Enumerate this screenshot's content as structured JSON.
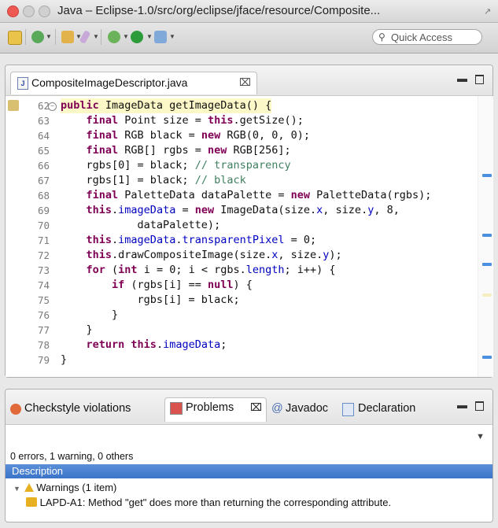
{
  "window": {
    "title": "Java – Eclipse-1.0/src/org/eclipse/jface/resource/Composite..."
  },
  "toolbar": {
    "quick_access_placeholder": "Quick Access"
  },
  "editor": {
    "tab_label": "CompositeImageDescriptor.java",
    "tab_close": "⌧",
    "lines": [
      {
        "n": "62",
        "segments": [
          {
            "t": "public ",
            "c": "kw"
          },
          {
            "t": "ImageData getImageData() {",
            "c": ""
          }
        ]
      },
      {
        "n": "63",
        "segments": [
          {
            "t": "    ",
            "c": ""
          },
          {
            "t": "final ",
            "c": "kw"
          },
          {
            "t": "Point size = ",
            "c": ""
          },
          {
            "t": "this",
            "c": "kw"
          },
          {
            "t": ".getSize();",
            "c": ""
          }
        ]
      },
      {
        "n": "64",
        "segments": [
          {
            "t": "    ",
            "c": ""
          },
          {
            "t": "final ",
            "c": "kw"
          },
          {
            "t": "RGB black = ",
            "c": ""
          },
          {
            "t": "new ",
            "c": "kw"
          },
          {
            "t": "RGB(0, 0, 0);",
            "c": ""
          }
        ]
      },
      {
        "n": "65",
        "segments": [
          {
            "t": "    ",
            "c": ""
          },
          {
            "t": "final ",
            "c": "kw"
          },
          {
            "t": "RGB[] rgbs = ",
            "c": ""
          },
          {
            "t": "new ",
            "c": "kw"
          },
          {
            "t": "RGB[256];",
            "c": ""
          }
        ]
      },
      {
        "n": "66",
        "segments": [
          {
            "t": "    rgbs[0] = black; ",
            "c": ""
          },
          {
            "t": "// transparency",
            "c": "cmt"
          }
        ]
      },
      {
        "n": "67",
        "segments": [
          {
            "t": "    rgbs[1] = black; ",
            "c": ""
          },
          {
            "t": "// black",
            "c": "cmt"
          }
        ]
      },
      {
        "n": "68",
        "segments": [
          {
            "t": "    ",
            "c": ""
          },
          {
            "t": "final ",
            "c": "kw"
          },
          {
            "t": "PaletteData dataPalette = ",
            "c": ""
          },
          {
            "t": "new ",
            "c": "kw"
          },
          {
            "t": "PaletteData(rgbs);",
            "c": ""
          }
        ]
      },
      {
        "n": "69",
        "segments": [
          {
            "t": "    ",
            "c": ""
          },
          {
            "t": "this",
            "c": "kw"
          },
          {
            "t": ".",
            "c": ""
          },
          {
            "t": "imageData",
            "c": "fld"
          },
          {
            "t": " = ",
            "c": ""
          },
          {
            "t": "new ",
            "c": "kw"
          },
          {
            "t": "ImageData(size.",
            "c": ""
          },
          {
            "t": "x",
            "c": "fld"
          },
          {
            "t": ", size.",
            "c": ""
          },
          {
            "t": "y",
            "c": "fld"
          },
          {
            "t": ", 8,",
            "c": ""
          }
        ]
      },
      {
        "n": "70",
        "segments": [
          {
            "t": "            dataPalette);",
            "c": ""
          }
        ]
      },
      {
        "n": "71",
        "segments": [
          {
            "t": "    ",
            "c": ""
          },
          {
            "t": "this",
            "c": "kw"
          },
          {
            "t": ".",
            "c": ""
          },
          {
            "t": "imageData",
            "c": "fld"
          },
          {
            "t": ".",
            "c": ""
          },
          {
            "t": "transparentPixel",
            "c": "fld"
          },
          {
            "t": " = 0;",
            "c": ""
          }
        ]
      },
      {
        "n": "72",
        "segments": [
          {
            "t": "    ",
            "c": ""
          },
          {
            "t": "this",
            "c": "kw"
          },
          {
            "t": ".drawCompositeImage(size.",
            "c": ""
          },
          {
            "t": "x",
            "c": "fld"
          },
          {
            "t": ", size.",
            "c": ""
          },
          {
            "t": "y",
            "c": "fld"
          },
          {
            "t": ");",
            "c": ""
          }
        ]
      },
      {
        "n": "73",
        "segments": [
          {
            "t": "    ",
            "c": ""
          },
          {
            "t": "for ",
            "c": "kw"
          },
          {
            "t": "(",
            "c": ""
          },
          {
            "t": "int ",
            "c": "kw"
          },
          {
            "t": "i = 0; i < rgbs.",
            "c": ""
          },
          {
            "t": "length",
            "c": "fld"
          },
          {
            "t": "; i++) {",
            "c": ""
          }
        ]
      },
      {
        "n": "74",
        "segments": [
          {
            "t": "        ",
            "c": ""
          },
          {
            "t": "if ",
            "c": "kw"
          },
          {
            "t": "(rgbs[i] == ",
            "c": ""
          },
          {
            "t": "null",
            "c": "kw"
          },
          {
            "t": ") {",
            "c": ""
          }
        ]
      },
      {
        "n": "75",
        "segments": [
          {
            "t": "            rgbs[i] = black;",
            "c": ""
          }
        ]
      },
      {
        "n": "76",
        "segments": [
          {
            "t": "        }",
            "c": ""
          }
        ]
      },
      {
        "n": "77",
        "segments": [
          {
            "t": "    }",
            "c": ""
          }
        ]
      },
      {
        "n": "78",
        "segments": [
          {
            "t": "    ",
            "c": ""
          },
          {
            "t": "return ",
            "c": "kw"
          },
          {
            "t": "this",
            "c": "kw"
          },
          {
            "t": ".",
            "c": ""
          },
          {
            "t": "imageData",
            "c": "fld"
          },
          {
            "t": ";",
            "c": ""
          }
        ]
      },
      {
        "n": "79",
        "segments": [
          {
            "t": "}",
            "c": ""
          }
        ]
      }
    ]
  },
  "bottom_panel": {
    "tabs": [
      {
        "label": "Checkstyle violations"
      },
      {
        "label": "Problems"
      },
      {
        "label": "Javadoc"
      },
      {
        "label": "Declaration"
      }
    ],
    "problems_close": "⌧",
    "summary": "0 errors, 1 warning, 0 others",
    "column_header": "Description",
    "group_label": "Warnings (1 item)",
    "warning_text": "LAPD-A1: Method \"get\" does more than returning the corresponding attribute."
  },
  "colors": {
    "keyword": "#7f0055",
    "field": "#0000c0",
    "comment": "#3f7f5f",
    "highlight": "#fdf8c8",
    "selection_header": "#3b74c9",
    "warning": "#e6b021"
  }
}
